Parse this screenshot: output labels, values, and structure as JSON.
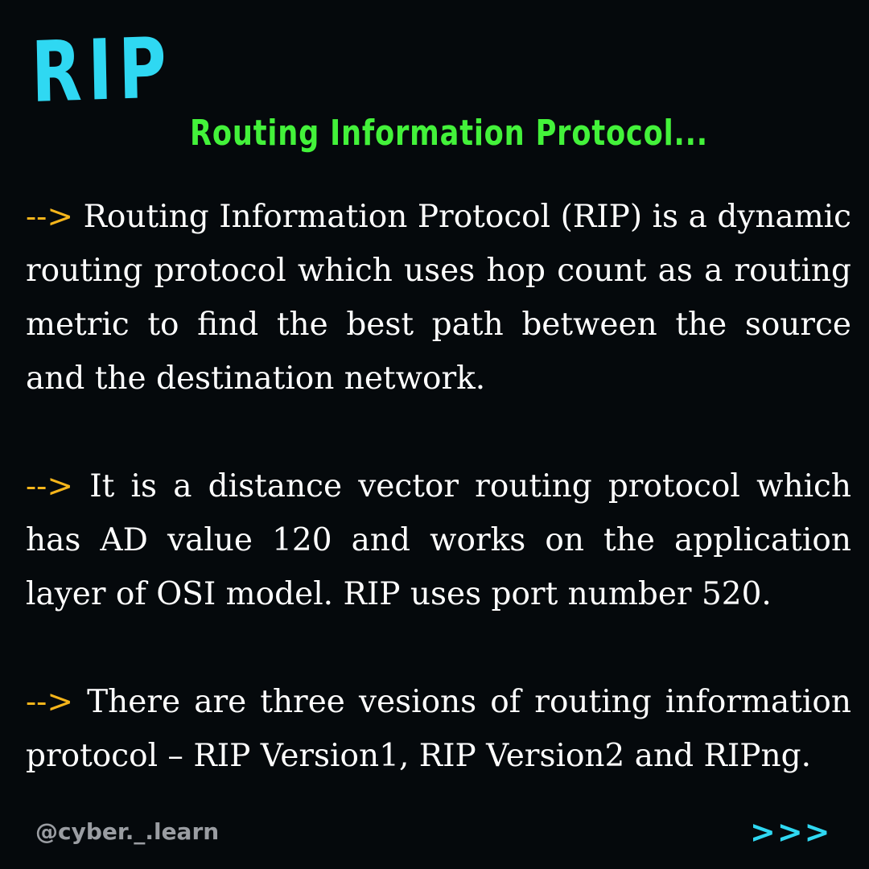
{
  "header": {
    "title": "RIP",
    "subtitle": "Routing Information Protocol..."
  },
  "colors": {
    "background": "#05090c",
    "title": "#2fd8f2",
    "subtitle": "#43f23a",
    "arrow": "#f5b51b",
    "body_text": "#ffffff",
    "handle": "#9a9da2"
  },
  "paragraphs": [
    {
      "arrow": "-->",
      "text": "Routing Information Protocol (RIP) is a dynamic routing protocol which uses hop count as a routing metric to find the best path between the source and the destination network."
    },
    {
      "arrow": "-->",
      "text": "It is a distance vector routing protocol which has AD value 120 and works on the application layer of OSI model. RIP uses port number 520."
    },
    {
      "arrow": "-->",
      "text": "There are three vesions of routing information protocol – RIP Version1, RIP Version2 and RIPng."
    }
  ],
  "footer": {
    "handle": "@cyber._.learn",
    "next_label": ">>>"
  }
}
